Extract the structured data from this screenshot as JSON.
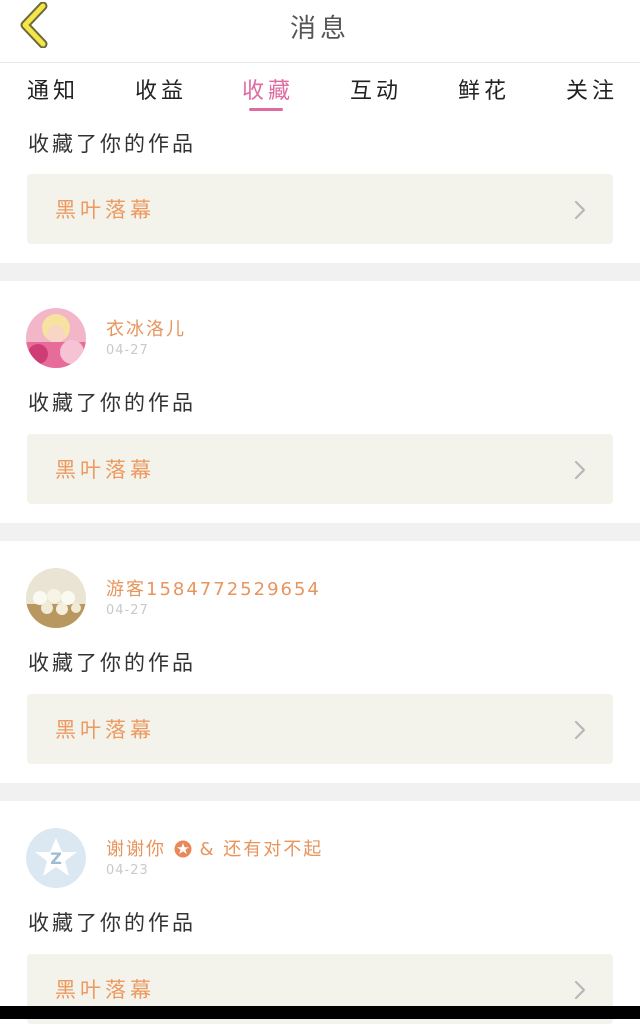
{
  "header": {
    "title": "消息"
  },
  "tabs": [
    {
      "label": "通知"
    },
    {
      "label": "收益"
    },
    {
      "label": "收藏"
    },
    {
      "label": "互动"
    },
    {
      "label": "鲜花"
    },
    {
      "label": "关注"
    }
  ],
  "active_tab": "收藏",
  "colors": {
    "accent": "#e06aa2",
    "work_title": "#ec9a5f",
    "username": "#e7955d",
    "work_bg": "#f3f3ec"
  },
  "feed": [
    {
      "action": "收藏了你的作品",
      "work_title": "黑叶落幕"
    },
    {
      "username": "衣冰洛儿",
      "date": "04-27",
      "action": "收藏了你的作品",
      "work_title": "黑叶落幕"
    },
    {
      "username": "游客1584772529654",
      "date": "04-27",
      "action": "收藏了你的作品",
      "work_title": "黑叶落幕"
    },
    {
      "username": "谢谢你",
      "username_suffix": "& 还有对不起",
      "date": "04-23",
      "action": "收藏了你的作品",
      "work_title": "黑叶落幕"
    }
  ],
  "icons": {
    "back": "chevron-left-icon",
    "arrow": "chevron-right-icon",
    "badge": "star-badge-icon"
  }
}
